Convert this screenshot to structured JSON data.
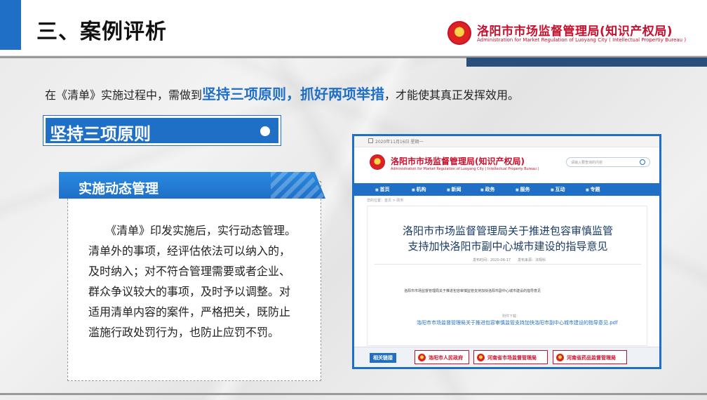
{
  "header": {
    "title": "三、案例评析",
    "logo_cn": "洛阳市市场监督管理局(知识产权局)",
    "logo_en": "Administration for Market Regulation of Luoyang City ( Intellectual Propertiy Bureau )"
  },
  "intro": {
    "before": "在《清单》实施过程中，需做到",
    "highlight1": "坚持三项原则",
    "separator": "，",
    "highlight2": "抓好两项举措",
    "after": "，才能使其真正发挥效用。"
  },
  "principle": {
    "label": "坚持三项原则"
  },
  "card": {
    "title": "实施动态管理",
    "lines": [
      "　　《清单》印发实施后，实行动态管理。",
      "清单外的事项，经评估依法可以纳入的，",
      "及时纳入；对不符合管理需要或者企业、",
      "群众争议较大的事项，及时予以调整。对",
      "适用清单内容的案件，严格把关，既防止",
      "滥施行政处罚行为，也防止应罚不罚。"
    ]
  },
  "screenshot": {
    "date": "2020年11月16日 星期一",
    "logo_cn": "洛阳市市场监督管理局(知识产权局)",
    "logo_en": "Administration for Market Regulation of Luoyang City ( Intellectual Property Bureau )",
    "search_placeholder": "请输入要查询的内容",
    "nav": [
      "首页",
      "机构",
      "新闻",
      "政务",
      "服务",
      "互动",
      "专题"
    ],
    "breadcrumb": "您的位置：首页 > 政务",
    "article_title": [
      "洛阳市市场监督管理局关于推进包容审慎监管",
      "支持加快洛阳市副中心城市建设的指导意见"
    ],
    "meta": "发布时间：2020-08-17　　发布来源：法规科",
    "paragraph": "洛阳市市场监督管理局关于推进包容审慎监管支持加快洛阳市副中心城市建设的指导意见",
    "attach_label": "附件下载：",
    "attachment": "洛阳市市场监督管理局关于推进包容审慎监管支持加快洛阳市副中心城市建设的指导意见.pdf",
    "related_label": "相关链接",
    "links": [
      "洛阳市人民政府",
      "河南省市场监督管理局",
      "河南省药品监督管理局"
    ]
  },
  "colors": {
    "brand_blue": "#1f6fc7",
    "brand_red": "#c8102e"
  }
}
